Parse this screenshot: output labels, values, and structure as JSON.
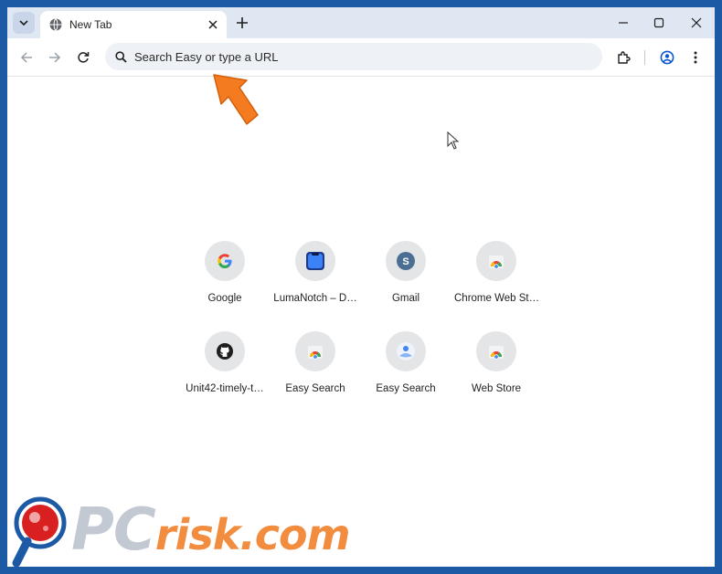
{
  "browser": {
    "tab": {
      "title": "New Tab"
    },
    "omnibox": {
      "placeholder": "Search Easy or type a URL"
    }
  },
  "shortcuts": [
    {
      "label": "Google",
      "icon": "google-icon"
    },
    {
      "label": "LumaNotch – D…",
      "icon": "lumanotch-icon"
    },
    {
      "label": "Gmail",
      "icon": "gmail-s-avatar-icon",
      "avatar_letter": "S"
    },
    {
      "label": "Chrome Web St…",
      "icon": "chrome-web-store-icon"
    },
    {
      "label": "Unit42-timely-t…",
      "icon": "github-icon"
    },
    {
      "label": "Easy Search",
      "icon": "chrome-web-store-icon"
    },
    {
      "label": "Easy Search",
      "icon": "easy-search-icon"
    },
    {
      "label": "Web Store",
      "icon": "chrome-web-store-icon"
    }
  ],
  "watermark": {
    "text": "PC",
    "suffix": "risk.com"
  },
  "colors": {
    "frame": "#1c5aa6",
    "tabstrip": "#dfe7f3",
    "omnibox": "#eef1f5",
    "arrow": "#f47b20",
    "watermark": "#f07a1f"
  }
}
